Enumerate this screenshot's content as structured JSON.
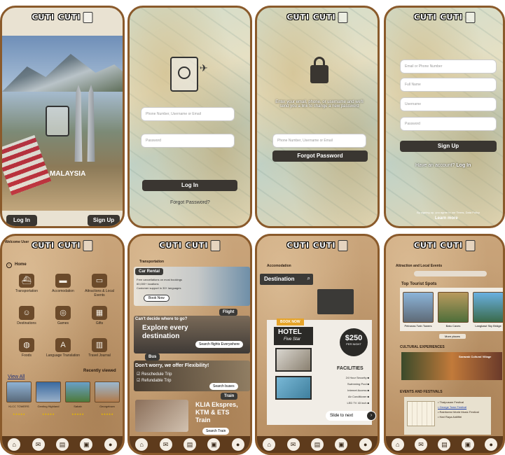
{
  "brand": {
    "logo": "CUTI CUTI"
  },
  "splash": {
    "country": "MALAYSIA",
    "login_label": "Log In",
    "signup_label": "Sign Up"
  },
  "login": {
    "username_placeholder": "Phone Number, Username or Email",
    "password_placeholder": "Password",
    "login_label": "Log In",
    "forgot_link": "Forgot Password?"
  },
  "forgot": {
    "instructions": "Enter your email, phone, or username and we'll send you a link to change a new password",
    "field_placeholder": "Phone Number, Username or Email",
    "button_label": "Forgot Password"
  },
  "signup": {
    "fields": [
      "Email or Phone Number",
      "Full Name",
      "Username",
      "Password"
    ],
    "button_label": "Sign Up",
    "have_account": "Have an account?",
    "login_link": "Log In",
    "terms": "By signing up, you agree to our Terms, Data Policy",
    "learn_more": "Learn more"
  },
  "home": {
    "welcome": "Welcome User",
    "section": "Home",
    "categories": [
      {
        "label": "Transportation",
        "icon": "ship-icon"
      },
      {
        "label": "Accomodation",
        "icon": "bed-icon"
      },
      {
        "label": "Attractions & Local Events",
        "icon": "ticket-icon"
      },
      {
        "label": "Destinations",
        "icon": "people-icon"
      },
      {
        "label": "Games",
        "icon": "gamepad-icon"
      },
      {
        "label": "Gifts",
        "icon": "gift-icon"
      },
      {
        "label": "Foods",
        "icon": "food-icon"
      },
      {
        "label": "Language Translation",
        "icon": "translate-icon"
      },
      {
        "label": "Travel Journal",
        "icon": "book-icon"
      }
    ],
    "view_all": "View All",
    "recently_viewed": "Recently viewed",
    "recent": [
      "KLCC TOWERS",
      "Genting Highland",
      "Sabah",
      "Georgetown"
    ],
    "rating": "★★★★★"
  },
  "transport": {
    "section": "Transportation",
    "car_title": "Car Rental",
    "car_points": [
      "Free cancellations on most bookings",
      "60,000+ locations",
      "Customer support in 30+ languages"
    ],
    "book_now": "Book Now",
    "flight_title": "Flight",
    "cant_decide": "Can't decide where to go?",
    "explore": "Explore every destination",
    "search_flights": "Search flights Everywhere",
    "bus_title": "Bus",
    "flexible": "Don't worry, we offer Flexibility!",
    "bus_points": [
      "Reschedule Trip",
      "Refundable Trip"
    ],
    "search_buses": "Search buses",
    "train_title": "Train",
    "train_text": "KLIA Ekspres, KTM & ETS Train",
    "search_train": "Search Train"
  },
  "accom": {
    "section": "Accomodation",
    "destination_label": "Destination",
    "book_now": "BOOK NOW",
    "hotel": "HOTEL",
    "stars": "Five Star",
    "price": "$250",
    "per_night": "PER NIGHT",
    "facilities_title": "FACILITIES",
    "facilities": [
      "24 Hour Security",
      "Swimming Pool",
      "Internet Access",
      "Air Conditioner",
      "LED TV 43 inch"
    ],
    "slide_next": "Slide to next"
  },
  "attract": {
    "section": "Attraction and Local Events",
    "top_spots": "Top Tourist Spots",
    "spots": [
      "Petronas Twin Towers",
      "Batu Caves",
      "Langkawi Sky Bridge"
    ],
    "more_places": "More places",
    "cultural": "CULTURAL EXPERIENCES",
    "village": "Sarawak Cultural Village",
    "events": "EVENTS AND FESTIVALS",
    "event_items": [
      "Thaipusam Festival",
      "George Town Festival",
      "Rainforest World Music Festival",
      "Hari Raya Aidilfitri"
    ]
  },
  "nav": [
    "home-icon",
    "mail-icon",
    "document-icon",
    "briefcase-icon",
    "profile-icon"
  ]
}
